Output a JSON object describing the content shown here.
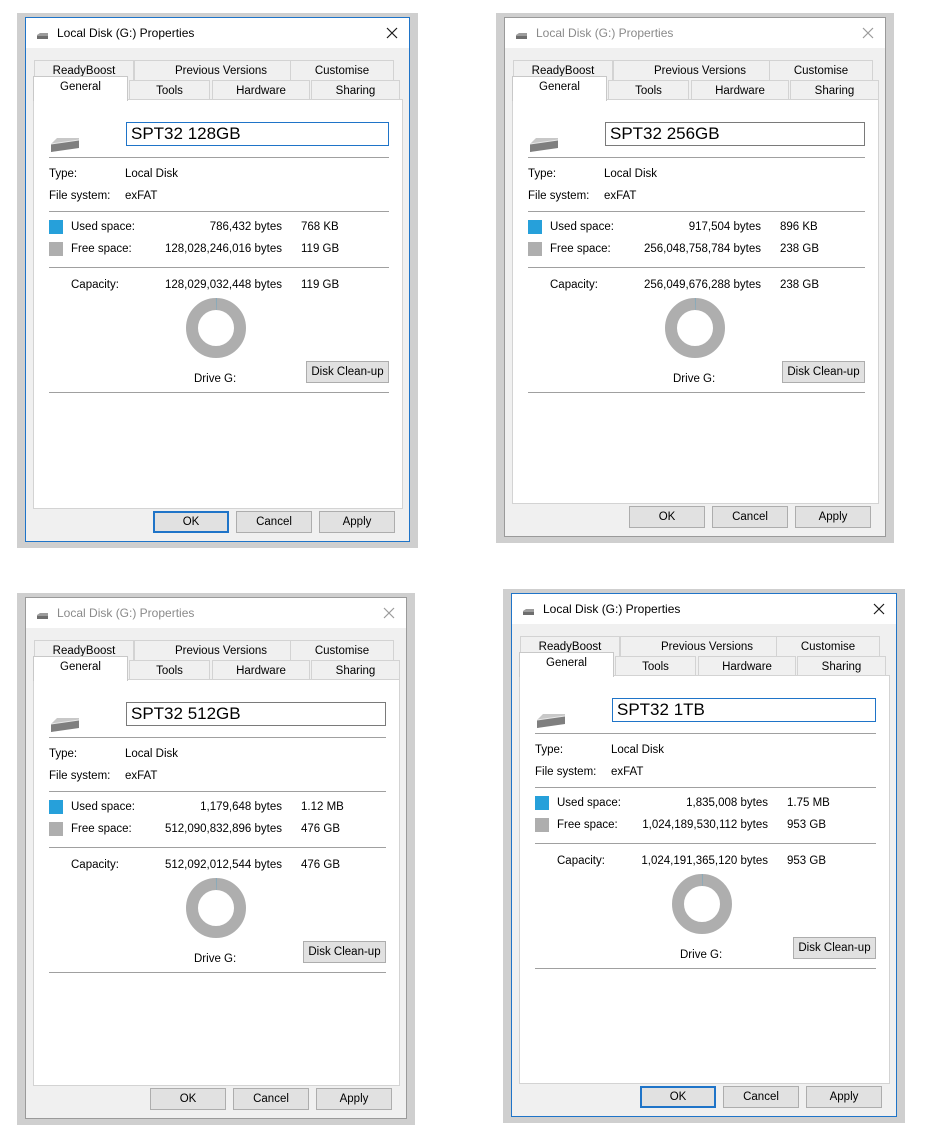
{
  "colors": {
    "used": "#26a0da",
    "free": "#aeaeae",
    "accent": "#1f74c8"
  },
  "icons": {
    "title": "drive-icon",
    "close": "close-icon",
    "drive": "drive-icon",
    "used": "used-swatch",
    "free": "free-swatch"
  },
  "common": {
    "tabs_row1": [
      "ReadyBoost",
      "Previous Versions",
      "Customise"
    ],
    "tabs_row2": [
      "General",
      "Tools",
      "Hardware",
      "Sharing"
    ],
    "type_label": "Type:",
    "type_value": "Local Disk",
    "fs_label": "File system:",
    "fs_value": "exFAT",
    "used_label": "Used space:",
    "free_label": "Free space:",
    "capacity_label": "Capacity:",
    "drive_label": "Drive G:",
    "cleanup_label": "Disk Clean-up",
    "ok_label": "OK",
    "cancel_label": "Cancel",
    "apply_label": "Apply"
  },
  "dialogs": [
    {
      "title": "Local Disk (G:) Properties",
      "name": "SPT32 128GB",
      "used_bytes": "786,432 bytes",
      "used_short": "768 KB",
      "free_bytes": "128,028,246,016 bytes",
      "free_short": "119 GB",
      "capacity_bytes": "128,029,032,448 bytes",
      "capacity_short": "119 GB",
      "used_fraction": 1e-05
    },
    {
      "title": "Local Disk (G:) Properties",
      "name": "SPT32 256GB",
      "used_bytes": "917,504 bytes",
      "used_short": "896 KB",
      "free_bytes": "256,048,758,784 bytes",
      "free_short": "238 GB",
      "capacity_bytes": "256,049,676,288 bytes",
      "capacity_short": "238 GB",
      "used_fraction": 1e-05
    },
    {
      "title": "Local Disk (G:) Properties",
      "name": "SPT32 512GB",
      "used_bytes": "1,179,648 bytes",
      "used_short": "1.12 MB",
      "free_bytes": "512,090,832,896 bytes",
      "free_short": "476 GB",
      "capacity_bytes": "512,092,012,544 bytes",
      "capacity_short": "476 GB",
      "used_fraction": 1e-05
    },
    {
      "title": "Local Disk (G:) Properties",
      "name": "SPT32 1TB",
      "used_bytes": "1,835,008 bytes",
      "used_short": "1.75 MB",
      "free_bytes": "1,024,189,530,112 bytes",
      "free_short": "953 GB",
      "capacity_bytes": "1,024,191,365,120 bytes",
      "capacity_short": "953 GB",
      "used_fraction": 1e-05
    }
  ]
}
